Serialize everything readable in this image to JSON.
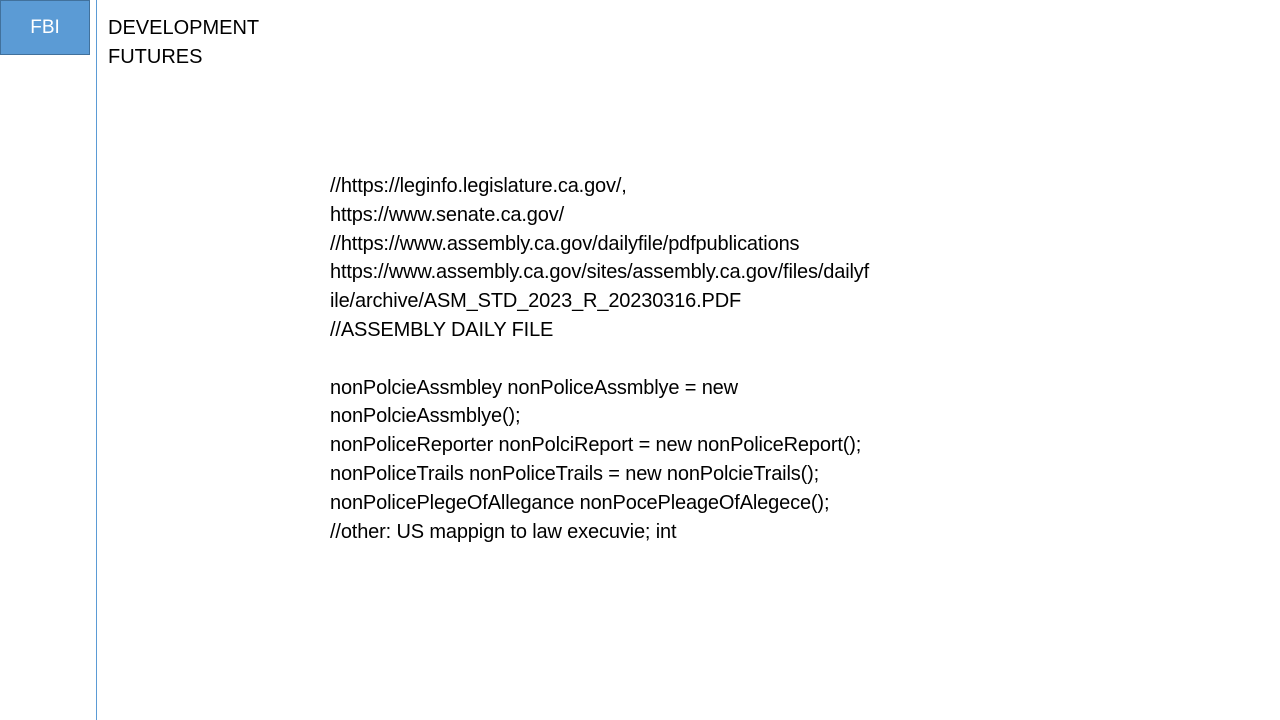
{
  "tag": {
    "label": "FBI",
    "color": "#5b9bd5"
  },
  "title": {
    "line1": "DEVELOPMENT",
    "line2": "FUTURES"
  },
  "body": {
    "lines": [
      "//https://leginfo.legislature.ca.gov/,",
      "https://www.senate.ca.gov/",
      "//https://www.assembly.ca.gov/dailyfile/pdfpublications",
      "https://www.assembly.ca.gov/sites/assembly.ca.gov/files/dailyf",
      "ile/archive/ASM_STD_2023_R_20230316.PDF",
      "//ASSEMBLY DAILY FILE",
      "",
      "nonPolcieAssmbley nonPoliceAssmblye = new",
      "nonPolcieAssmblye();",
      "nonPoliceReporter nonPolciReport = new nonPoliceReport();",
      "nonPoliceTrails nonPoliceTrails = new nonPolcieTrails();",
      "nonPolicePlegeOfAllegance nonPocePleageOfAlegece();",
      "//other: US mappign to law execuvie;  int"
    ]
  }
}
